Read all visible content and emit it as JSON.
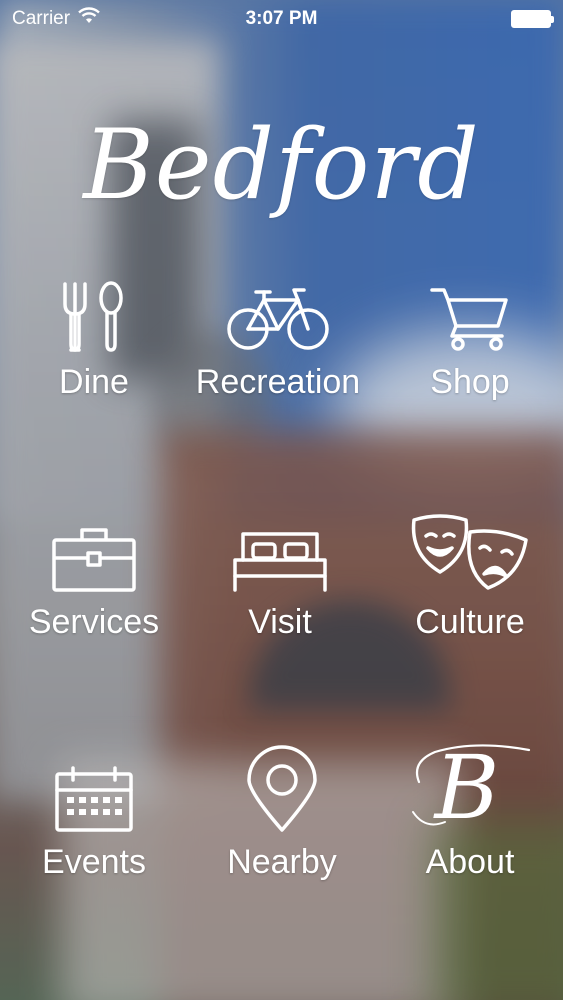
{
  "status_bar": {
    "carrier": "Carrier",
    "time": "3:07 PM"
  },
  "app": {
    "logo_text": "Bedford"
  },
  "menu": {
    "items": [
      {
        "label": "Dine",
        "icon": "fork-spoon-icon"
      },
      {
        "label": "Recreation",
        "icon": "bicycle-icon"
      },
      {
        "label": "Shop",
        "icon": "shopping-cart-icon"
      },
      {
        "label": "Services",
        "icon": "briefcase-icon"
      },
      {
        "label": "Visit",
        "icon": "bed-icon"
      },
      {
        "label": "Culture",
        "icon": "theater-masks-icon"
      },
      {
        "label": "Events",
        "icon": "calendar-icon"
      },
      {
        "label": "Nearby",
        "icon": "location-pin-icon"
      },
      {
        "label": "About",
        "icon": "bedford-b-icon"
      }
    ]
  },
  "colors": {
    "foreground": "#ffffff",
    "sky": "#3a6fc0",
    "brick": "#7a4a3a"
  }
}
